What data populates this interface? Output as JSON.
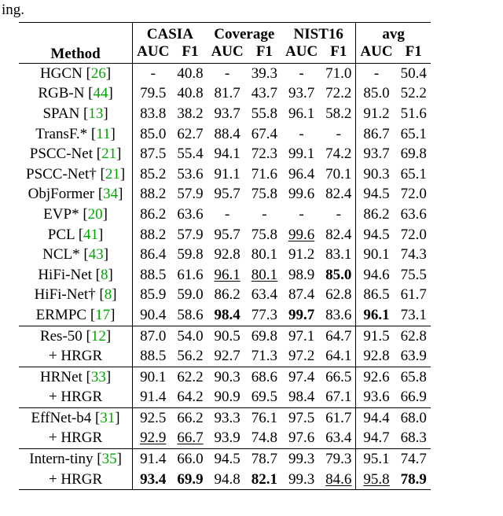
{
  "fragment": "ing.",
  "headers": {
    "method": "Method",
    "groups": [
      "CASIA",
      "Coverage",
      "NIST16",
      "avg"
    ],
    "sub": [
      "AUC",
      "F1",
      "AUC",
      "F1",
      "AUC",
      "F1",
      "AUC",
      "F1"
    ]
  },
  "rows": [
    {
      "sep": "top",
      "name": "HGCN",
      "cite": "26",
      "v": [
        "-",
        "40.8",
        "-",
        "39.3",
        "-",
        "71.0",
        "-",
        "50.4"
      ]
    },
    {
      "name": "RGB-N",
      "cite": "44",
      "v": [
        "79.5",
        "40.8",
        "81.7",
        "43.7",
        "93.7",
        "72.2",
        "85.0",
        "52.2"
      ]
    },
    {
      "name": "SPAN",
      "cite": "13",
      "v": [
        "83.8",
        "38.2",
        "93.7",
        "55.8",
        "96.1",
        "58.2",
        "91.2",
        "51.6"
      ]
    },
    {
      "name": "TransF.*",
      "cite": "11",
      "v": [
        "85.0",
        "62.7",
        "88.4",
        "67.4",
        "-",
        "-",
        "86.7",
        "65.1"
      ]
    },
    {
      "name": "PSCC-Net",
      "cite": "21",
      "v": [
        "87.5",
        "55.4",
        "94.1",
        "72.3",
        "99.1",
        "74.2",
        "93.7",
        "69.8"
      ]
    },
    {
      "name": "PSCC-Net†",
      "cite": "21",
      "v": [
        "85.2",
        "53.6",
        "91.1",
        "71.6",
        "96.4",
        "70.1",
        "90.3",
        "65.1"
      ]
    },
    {
      "name": "ObjFormer",
      "cite": "34",
      "v": [
        "88.2",
        "57.9",
        "95.7",
        "75.8",
        "99.6",
        "82.4",
        "94.5",
        "72.0"
      ]
    },
    {
      "name": "EVP*",
      "cite": "20",
      "v": [
        "86.2",
        "63.6",
        "-",
        "-",
        "-",
        "-",
        "86.2",
        "63.6"
      ]
    },
    {
      "name": "PCL",
      "cite": "41",
      "v": [
        "88.2",
        "57.9",
        "95.7",
        "75.8",
        {
          "t": "99.6",
          "u": true
        },
        "82.4",
        "94.5",
        "72.0"
      ]
    },
    {
      "name": "NCL*",
      "cite": "43",
      "v": [
        "86.4",
        "59.8",
        "92.8",
        "80.1",
        "91.2",
        "83.1",
        "90.1",
        "74.3"
      ]
    },
    {
      "name": "HiFi-Net",
      "cite": "8",
      "v": [
        "88.5",
        "61.6",
        {
          "t": "96.1",
          "u": true
        },
        {
          "t": "80.1",
          "u": true
        },
        "98.9",
        {
          "t": "85.0",
          "b": true
        },
        "94.6",
        "75.5"
      ]
    },
    {
      "name": "HiFi-Net†",
      "cite": "8",
      "v": [
        "85.9",
        "59.0",
        "86.2",
        "63.4",
        "87.4",
        "62.8",
        "86.5",
        "61.7"
      ]
    },
    {
      "name": "ERMPC",
      "cite": "17",
      "v": [
        "90.4",
        "58.6",
        {
          "t": "98.4",
          "b": true
        },
        "77.3",
        {
          "t": "99.7",
          "b": true
        },
        "83.6",
        {
          "t": "96.1",
          "b": true
        },
        "73.1"
      ]
    },
    {
      "sep": "mid",
      "name": "Res-50",
      "cite": "12",
      "v": [
        "87.0",
        "54.0",
        "90.5",
        "69.8",
        "97.1",
        "64.7",
        "91.5",
        "62.8"
      ]
    },
    {
      "name": "+ HRGR",
      "v": [
        "88.5",
        "56.2",
        "92.7",
        "71.3",
        "97.2",
        "64.1",
        "92.8",
        "63.9"
      ]
    },
    {
      "sep": "mid",
      "name": "HRNet",
      "cite": "33",
      "v": [
        "90.1",
        "62.2",
        "90.3",
        "68.6",
        "97.4",
        "66.5",
        "92.6",
        "65.8"
      ]
    },
    {
      "name": "+ HRGR",
      "v": [
        "91.4",
        "64.2",
        "90.9",
        "69.5",
        "98.4",
        "67.1",
        "93.6",
        "66.9"
      ]
    },
    {
      "sep": "mid",
      "name": "EffNet-b4",
      "cite": "31",
      "v": [
        "92.5",
        "66.2",
        "93.3",
        "76.1",
        "97.5",
        "61.7",
        "94.4",
        "68.0"
      ]
    },
    {
      "name": "+ HRGR",
      "v": [
        {
          "t": "92.9",
          "u": true
        },
        {
          "t": "66.7",
          "u": true
        },
        "93.9",
        "74.8",
        "97.6",
        "63.4",
        "94.7",
        "68.3"
      ]
    },
    {
      "sep": "mid",
      "name": "Intern-tiny",
      "cite": "35",
      "v": [
        "91.4",
        "66.0",
        "94.5",
        "78.7",
        "99.3",
        "79.3",
        "95.1",
        "74.7"
      ]
    },
    {
      "sep": "bot",
      "name": "+ HRGR",
      "v": [
        {
          "t": "93.4",
          "b": true
        },
        {
          "t": "69.9",
          "b": true
        },
        "94.8",
        {
          "t": "82.1",
          "b": true
        },
        "99.3",
        {
          "t": "84.6",
          "u": true
        },
        {
          "t": "95.8",
          "u": true
        },
        {
          "t": "78.9",
          "b": true
        }
      ]
    }
  ],
  "chart_data": {
    "type": "table",
    "title": "Method comparison: AUC and F1 on CASIA, Coverage, NIST16, and avg",
    "columns": [
      "Method",
      "CASIA AUC",
      "CASIA F1",
      "Coverage AUC",
      "Coverage F1",
      "NIST16 AUC",
      "NIST16 F1",
      "avg AUC",
      "avg F1"
    ],
    "rows": [
      [
        "HGCN [26]",
        null,
        40.8,
        null,
        39.3,
        null,
        71.0,
        null,
        50.4
      ],
      [
        "RGB-N [44]",
        79.5,
        40.8,
        81.7,
        43.7,
        93.7,
        72.2,
        85.0,
        52.2
      ],
      [
        "SPAN [13]",
        83.8,
        38.2,
        93.7,
        55.8,
        96.1,
        58.2,
        91.2,
        51.6
      ],
      [
        "TransF.* [11]",
        85.0,
        62.7,
        88.4,
        67.4,
        null,
        null,
        86.7,
        65.1
      ],
      [
        "PSCC-Net [21]",
        87.5,
        55.4,
        94.1,
        72.3,
        99.1,
        74.2,
        93.7,
        69.8
      ],
      [
        "PSCC-Net† [21]",
        85.2,
        53.6,
        91.1,
        71.6,
        96.4,
        70.1,
        90.3,
        65.1
      ],
      [
        "ObjFormer [34]",
        88.2,
        57.9,
        95.7,
        75.8,
        99.6,
        82.4,
        94.5,
        72.0
      ],
      [
        "EVP* [20]",
        86.2,
        63.6,
        null,
        null,
        null,
        null,
        86.2,
        63.6
      ],
      [
        "PCL [41]",
        88.2,
        57.9,
        95.7,
        75.8,
        99.6,
        82.4,
        94.5,
        72.0
      ],
      [
        "NCL* [43]",
        86.4,
        59.8,
        92.8,
        80.1,
        91.2,
        83.1,
        90.1,
        74.3
      ],
      [
        "HiFi-Net [8]",
        88.5,
        61.6,
        96.1,
        80.1,
        98.9,
        85.0,
        94.6,
        75.5
      ],
      [
        "HiFi-Net† [8]",
        85.9,
        59.0,
        86.2,
        63.4,
        87.4,
        62.8,
        86.5,
        61.7
      ],
      [
        "ERMPC [17]",
        90.4,
        58.6,
        98.4,
        77.3,
        99.7,
        83.6,
        96.1,
        73.1
      ],
      [
        "Res-50 [12]",
        87.0,
        54.0,
        90.5,
        69.8,
        97.1,
        64.7,
        91.5,
        62.8
      ],
      [
        "+ HRGR",
        88.5,
        56.2,
        92.7,
        71.3,
        97.2,
        64.1,
        92.8,
        63.9
      ],
      [
        "HRNet [33]",
        90.1,
        62.2,
        90.3,
        68.6,
        97.4,
        66.5,
        92.6,
        65.8
      ],
      [
        "+ HRGR",
        91.4,
        64.2,
        90.9,
        69.5,
        98.4,
        67.1,
        93.6,
        66.9
      ],
      [
        "EffNet-b4 [31]",
        92.5,
        66.2,
        93.3,
        76.1,
        97.5,
        61.7,
        94.4,
        68.0
      ],
      [
        "+ HRGR",
        92.9,
        66.7,
        93.9,
        74.8,
        97.6,
        63.4,
        94.7,
        68.3
      ],
      [
        "Intern-tiny [35]",
        91.4,
        66.0,
        94.5,
        78.7,
        99.3,
        79.3,
        95.1,
        74.7
      ],
      [
        "+ HRGR",
        93.4,
        69.9,
        94.8,
        82.1,
        99.3,
        84.6,
        95.8,
        78.9
      ]
    ]
  }
}
